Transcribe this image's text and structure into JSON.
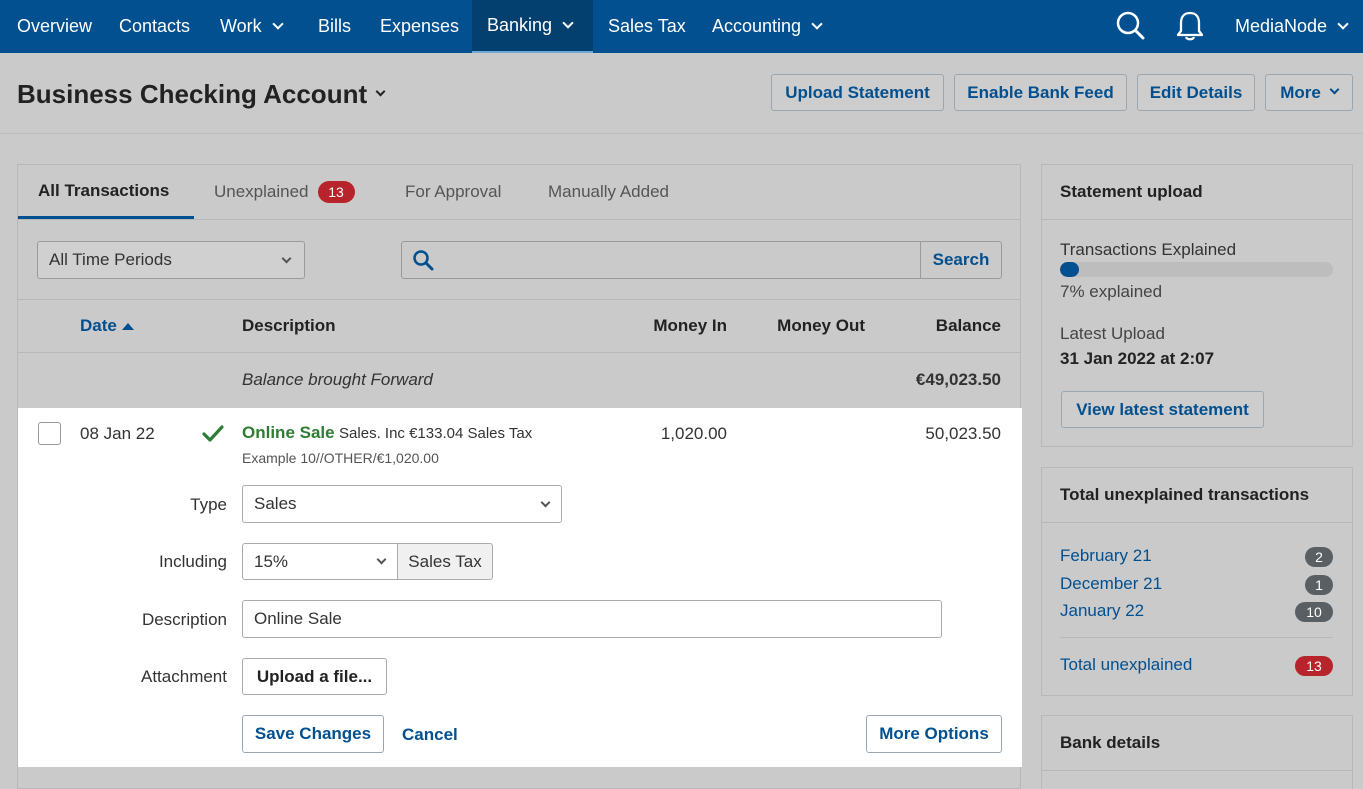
{
  "topnav": {
    "items": [
      {
        "label": "Overview"
      },
      {
        "label": "Contacts"
      },
      {
        "label": "Work"
      },
      {
        "label": "Bills"
      },
      {
        "label": "Expenses"
      },
      {
        "label": "Banking"
      },
      {
        "label": "Sales Tax"
      },
      {
        "label": "Accounting"
      }
    ],
    "user": "MediaNode"
  },
  "header": {
    "title": "Business Checking Account",
    "buttons": {
      "upload": "Upload Statement",
      "bank_feed": "Enable Bank Feed",
      "edit": "Edit Details",
      "more": "More"
    }
  },
  "tabs": {
    "all": "All Transactions",
    "unexplained": "Unexplained",
    "unexplained_count": "13",
    "approval": "For Approval",
    "manual": "Manually Added"
  },
  "filter": {
    "period": "All Time Periods",
    "search_placeholder": "",
    "search_button": "Search"
  },
  "table": {
    "headers": {
      "date": "Date",
      "description": "Description",
      "money_in": "Money In",
      "money_out": "Money Out",
      "balance": "Balance"
    },
    "brought_forward": {
      "label": "Balance brought Forward",
      "balance": "€49,023.50"
    },
    "row": {
      "date": "08 Jan 22",
      "title": "Online Sale",
      "detail": "Sales. Inc €133.04 Sales Tax",
      "reference": "Example 10//OTHER/€1,020.00",
      "money_in": "1,020.00",
      "balance": "50,023.50"
    }
  },
  "form": {
    "type_label": "Type",
    "type_value": "Sales",
    "including_label": "Including",
    "including_value": "15%",
    "tax_addon": "Sales Tax",
    "description_label": "Description",
    "description_value": "Online Sale",
    "attachment_label": "Attachment",
    "upload_button": "Upload a file...",
    "save": "Save Changes",
    "cancel": "Cancel",
    "more_options": "More Options"
  },
  "sidebar": {
    "statement": {
      "title": "Statement upload",
      "explained_label": "Transactions Explained",
      "progress_fraction": 0.07,
      "explained_text": "7% explained",
      "latest_label": "Latest Upload",
      "latest_value": "31 Jan 2022 at 2:07",
      "view_button": "View latest statement"
    },
    "unexplained": {
      "title": "Total unexplained transactions",
      "items": [
        {
          "label": "February 21",
          "count": "2"
        },
        {
          "label": "December 21",
          "count": "1"
        },
        {
          "label": "January 22",
          "count": "10"
        }
      ],
      "total_label": "Total unexplained",
      "total_count": "13"
    },
    "bank": {
      "title": "Bank details"
    }
  },
  "colors": {
    "nav": "#02508f",
    "accent": "#02508f",
    "badge": "#b7242b",
    "success": "#2e7d32"
  }
}
